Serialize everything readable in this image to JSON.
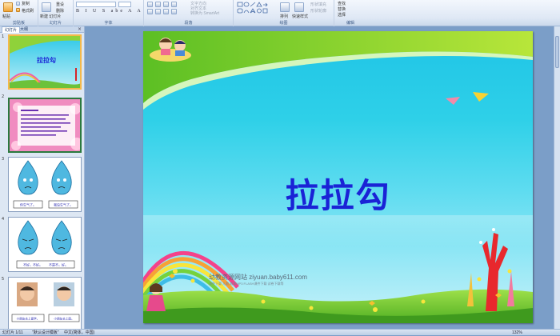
{
  "ribbon": {
    "clipboard": {
      "paste": "粘贴",
      "copy": "复制",
      "format_painter": "格式刷",
      "group_label": "剪贴板"
    },
    "slides": {
      "new_slide": "新建\n幻灯片",
      "reset": "重设",
      "delete": "删除",
      "group_label": "幻灯片"
    },
    "font": {
      "group_label": "字体"
    },
    "paragraph": {
      "text_direction": "文字方向",
      "align_text": "对齐文本",
      "smartart": "转换为 SmartArt",
      "group_label": "段落"
    },
    "drawing": {
      "arrange": "排列",
      "quick_styles": "快速样式",
      "shape_fill": "形状填充",
      "shape_outline": "形状轮廓",
      "group_label": "绘图"
    },
    "editing": {
      "find": "查找",
      "replace": "替换",
      "select": "选择",
      "group_label": "编辑"
    }
  },
  "left_pane": {
    "tabs": [
      "幻灯片",
      "大纲"
    ],
    "close": "×",
    "thumbnails": [
      {
        "number": "1",
        "title": "拉拉勾"
      },
      {
        "number": "2",
        "title": ""
      },
      {
        "number": "3",
        "captions": [
          "你生气了。",
          "我没生气了。"
        ]
      },
      {
        "number": "4",
        "captions": [
          "不好，不好。",
          "不是不，好。"
        ]
      },
      {
        "number": "5",
        "captions": [
          "小朋友去上面学。",
          "小朋友去上面。"
        ]
      }
    ]
  },
  "slide": {
    "title": "拉拉勾",
    "watermark": "幼教资源网站  ziyuan.baby611.com",
    "watermark_sub": "课件下载    儿歌    故事MP3    FLASH课件下载    试卷下载等"
  },
  "status_bar": {
    "slide_info": "幻灯片 1/11",
    "theme": "\"默认设计模板\"",
    "language": "中文(简体，中国)",
    "zoom": "132%"
  },
  "colors": {
    "title": "#1a23d6",
    "ribbon_bg": "#dfe8f5",
    "selected_thumb": "#f5b94a"
  }
}
